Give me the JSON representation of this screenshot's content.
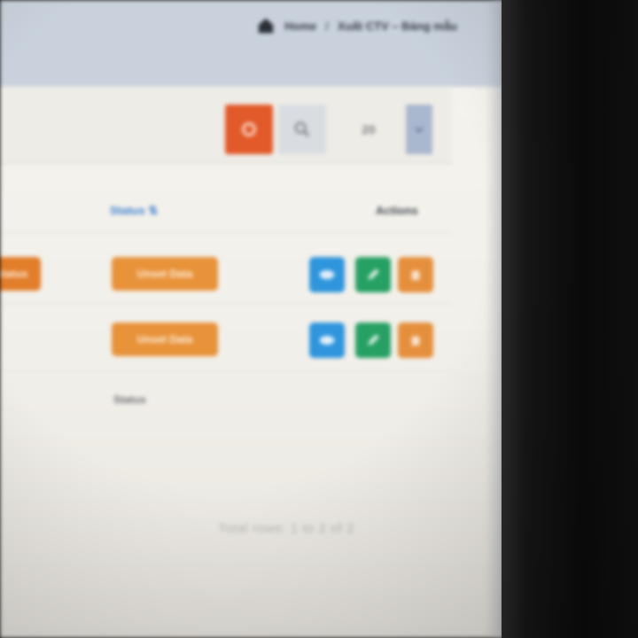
{
  "breadcrumb": {
    "home": "Home",
    "current": "Xuất CTV – Bảng mẫu"
  },
  "toolbar": {
    "page_size": "20"
  },
  "table": {
    "headers": {
      "status": "Status ⇅",
      "actions": "Actions"
    },
    "rows": [
      {
        "left_badge": "Status",
        "status": "Unset Data"
      },
      {
        "status": "Unset Data"
      }
    ],
    "footer_status": "Status"
  },
  "summary": "Total rows: 1 to 2 of 2",
  "icons": {
    "home": "home-icon",
    "reset": "reset-icon",
    "search": "search-icon",
    "dropdown": "chevron-down-icon",
    "view": "eye-icon",
    "edit": "pencil-icon",
    "delete": "trash-icon"
  },
  "colors": {
    "reset": "#e25a2a",
    "status_badge": "#e8923a",
    "view": "#2f95dd",
    "edit": "#26a063",
    "delete": "#e58f3c",
    "sort_header": "#3a7fd0"
  }
}
